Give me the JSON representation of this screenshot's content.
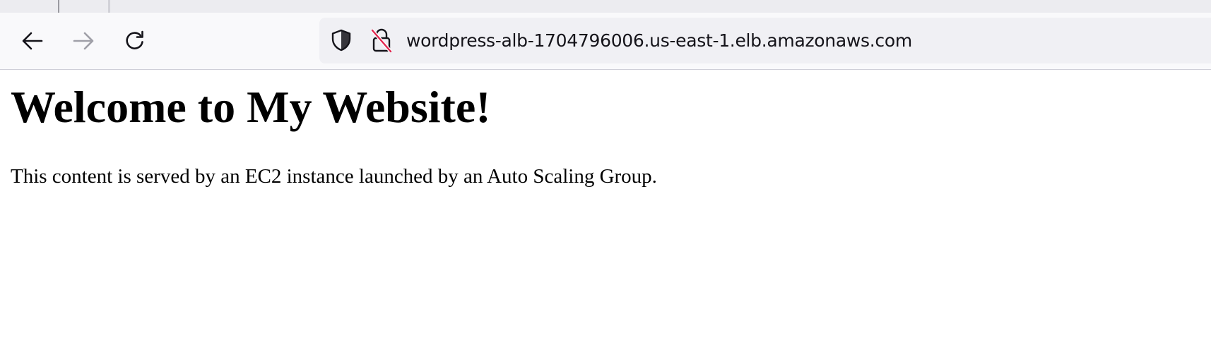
{
  "browser": {
    "url": "wordpress-alb-1704796006.us-east-1.elb.amazonaws.com",
    "icons": {
      "back": "arrow-left-icon",
      "forward": "arrow-right-icon",
      "reload": "reload-icon",
      "tracking_protection": "shield-icon",
      "connection": "insecure-lock-icon"
    },
    "colors": {
      "toolbar_bg": "#f9f9fb",
      "urlbar_bg": "#f0f0f4",
      "insecure_slash": "#e22850"
    }
  },
  "page": {
    "heading": "Welcome to My Website!",
    "body": "This content is served by an EC2 instance launched by an Auto Scaling Group."
  }
}
